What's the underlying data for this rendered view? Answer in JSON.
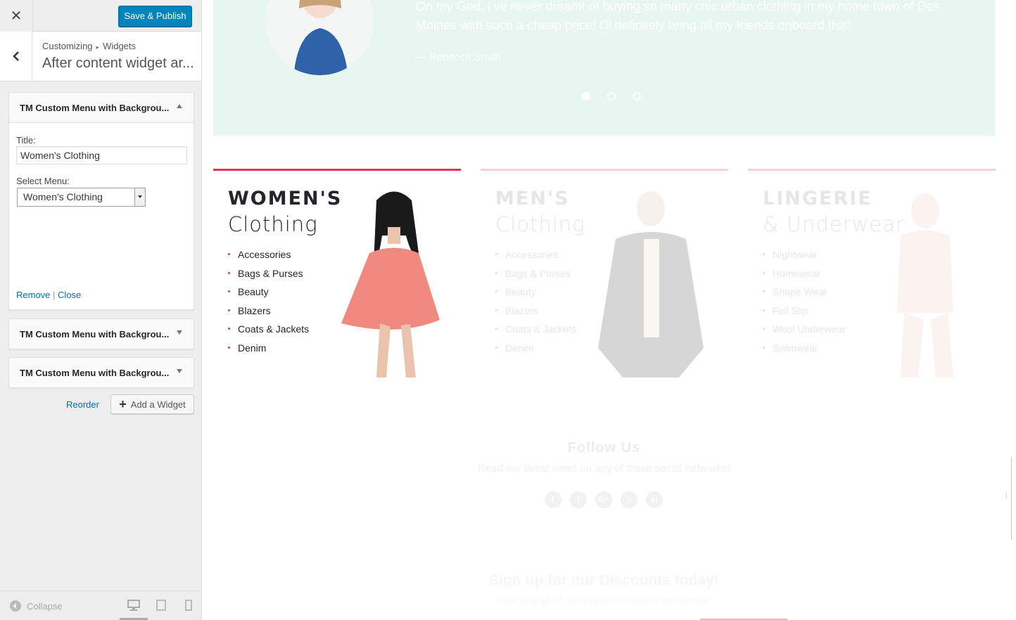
{
  "header": {
    "save_label": "Save & Publish"
  },
  "breadcrumb": {
    "root": "Customizing",
    "current": "Widgets"
  },
  "section_title": "After content widget ar...",
  "widgets": [
    {
      "title": "TM Custom Menu with Backgrou...",
      "expanded": true,
      "title_label": "Title:",
      "title_value": "Women's Clothing",
      "menu_label": "Select Menu:",
      "menu_value": "Women's Clothing",
      "remove_label": "Remove",
      "close_label": "Close"
    },
    {
      "title": "TM Custom Menu with Backgrou...",
      "expanded": false
    },
    {
      "title": "TM Custom Menu with Backgrou...",
      "expanded": false
    }
  ],
  "actions": {
    "reorder_label": "Reorder",
    "add_widget_label": "Add a Widget"
  },
  "footer": {
    "collapse_label": "Collapse",
    "devices": [
      "desktop-icon",
      "tablet-icon",
      "mobile-icon"
    ]
  },
  "preview": {
    "testimonial": {
      "quote": "On my God, I've never dreamt of buying so many chic urban clothing in my home town of Des Moines with such a cheap price! I'll definitely bring all my friends onboard this!",
      "author": "— Rebecca Smith",
      "slide_count": 3,
      "active_slide": 1
    },
    "categories": [
      {
        "title_line1": "WOMEN'S",
        "title_line2": "Clothing",
        "items": [
          "Accessories",
          "Bags & Purses",
          "Beauty",
          "Blazers",
          "Coats & Jackets",
          "Denim"
        ]
      },
      {
        "title_line1": "MEN'S",
        "title_line2": "Clothing",
        "items": [
          "Accessories",
          "Bags & Purses",
          "Beauty",
          "Blazers",
          "Coats & Jackets",
          "Denim"
        ]
      },
      {
        "title_line1": "LINGERIE",
        "title_line2": "& Underwear",
        "items": [
          "Nightwear",
          "Homewear",
          "Shape Wear",
          "Full Slip",
          "Wool Underwear",
          "Swimwear"
        ]
      }
    ],
    "follow": {
      "title": "Follow Us",
      "subtitle": "Read our latest news on any of these social networks!",
      "networks": [
        {
          "icon": "facebook-icon",
          "glyph": "f"
        },
        {
          "icon": "twitter-icon",
          "glyph": "t"
        },
        {
          "icon": "google-plus-icon",
          "glyph": "G+"
        },
        {
          "icon": "instagram-icon",
          "glyph": "◎"
        },
        {
          "icon": "linkedin-icon",
          "glyph": "in"
        }
      ]
    },
    "signup": {
      "title": "Sign up for our Discounts today!",
      "subtitle": "And buy all of our apparel cheaper tomorrow!"
    }
  },
  "colors": {
    "accent": "#e2344b",
    "wp_blue": "#0085ba",
    "link_blue": "#0073aa",
    "testimonial_bg": "#e7f6f0"
  }
}
